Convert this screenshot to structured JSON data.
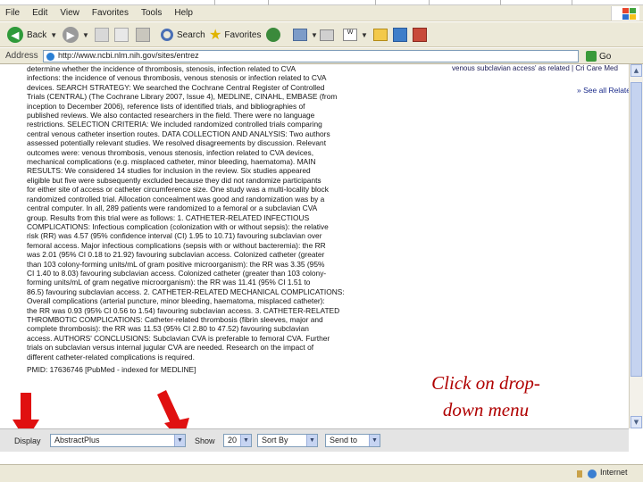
{
  "menu": [
    "File",
    "Edit",
    "View",
    "Favorites",
    "Tools",
    "Help"
  ],
  "toolbar": {
    "back_label": "Back",
    "search_label": "Search",
    "favorites_label": "Favorites"
  },
  "address": {
    "label": "Address",
    "url": "http://www.ncbi.nlm.nih.gov/sites/entrez",
    "go_label": "Go"
  },
  "abstract_lines": [
    "determine whether the incidence of thrombosis, stenosis, infection related to CVA",
    "infections: the incidence of venous thrombosis, venous stenosis or infection related to CVA",
    "devices. SEARCH STRATEGY: We searched the Cochrane Central Register of Controlled",
    "Trials (CENTRAL) (The Cochrane Library 2007, Issue 4), MEDLINE, CINAHL, EMBASE (from",
    "inception to December 2006), reference lists of identified trials, and bibliographies of",
    "published reviews. We also contacted researchers in the field. There were no language",
    "restrictions. SELECTION CRITERIA: We included randomized controlled trials comparing",
    "central venous catheter insertion routes. DATA COLLECTION AND ANALYSIS: Two authors",
    "assessed potentially relevant studies. We resolved disagreements by discussion. Relevant",
    "outcomes were: venous thrombosis, venous stenosis, infection related to CVA devices,",
    "mechanical complications (e.g. misplaced catheter, minor bleeding, haematoma). MAIN",
    "RESULTS: We considered 14 studies for inclusion in the review. Six studies appeared",
    "eligible but five were subsequently excluded because they did not randomize participants",
    "for either site of access or catheter circumference size. One study was a multi-locality block",
    "randomized controlled trial. Allocation concealment was good and randomization was by a",
    "central computer. In all, 289 patients were randomized to a femoral or a subclavian CVA",
    "group. Results from this trial were as follows: 1. CATHETER-RELATED INFECTIOUS",
    "COMPLICATIONS: Infectious complication (colonization with or without sepsis): the relative",
    "risk (RR) was 4.57 (95% confidence interval (CI) 1.95 to 10.71) favouring subclavian over",
    "femoral access. Major infectious complications (sepsis with or without bacteremia): the RR",
    "was 2.01 (95% CI 0.18 to 21.92) favouring subclavian access. Colonized catheter (greater",
    "than 103 colony-forming units/mL of gram positive microorganism): the RR was 3.35 (95%",
    "CI 1.40 to 8.03) favouring subclavian access. Colonized catheter (greater than 103 colony-",
    "forming units/mL of gram negative microorganism): the RR was 11.41 (95% CI 1.51 to",
    "86.5) favouring subclavian access. 2. CATHETER-RELATED MECHANICAL COMPLICATIONS:",
    "Overall complications (arterial puncture, minor bleeding, haematoma, misplaced catheter):",
    "the RR was 0.93 (95% CI 0.56 to 1.54) favouring subclavian access. 3. CATHETER-RELATED",
    "THROMBOTIC COMPLICATIONS: Catheter-related thrombosis (fibrin sleeves, major and",
    "complete thrombosis): the RR was 11.53 (95% CI 2.80 to 47.52) favouring subclavian",
    "access. AUTHORS' CONCLUSIONS: Subclavian CVA is preferable to femoral CVA. Further",
    "trials on subclavian versus internal jugular CVA are needed. Research on the impact of",
    "different catheter-related complications is required."
  ],
  "pmid_line": "PMID: 17636746 [PubMed - indexed for MEDLINE]",
  "right_col_text": "venous subclavian access' as related | Cri Care Med",
  "related_link": "» See all Related Articles",
  "annotation": {
    "line1": "Click on drop-",
    "line2": "down menu"
  },
  "display_bar": {
    "display_label": "Display",
    "format_value": "AbstractPlus",
    "show_label": "Show",
    "show_value": "20",
    "sort_value": "Sort By",
    "send_value": "Send to"
  },
  "status": {
    "zone": "Internet"
  },
  "colors": {
    "annotation": "#b00000",
    "arrow": "#e01010"
  }
}
